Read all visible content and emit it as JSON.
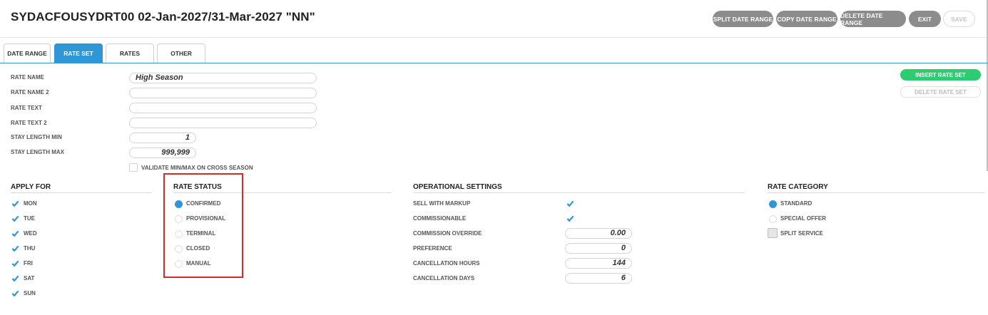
{
  "header": {
    "title": "SYDACFOUSYDRT00 02-Jan-2027/31-Mar-2027 \"NN\"",
    "buttons": {
      "split_date_range": "SPLIT DATE RANGE",
      "copy_date_range": "COPY DATE RANGE",
      "delete_date_range": "DELETE DATE RANGE",
      "exit": "EXIT",
      "save": "SAVE"
    }
  },
  "tabs": [
    {
      "label": "DATE RANGE",
      "active": false
    },
    {
      "label": "RATE SET",
      "active": true
    },
    {
      "label": "RATES",
      "active": false
    },
    {
      "label": "OTHER",
      "active": false
    }
  ],
  "form": {
    "rate_name": {
      "label": "RATE NAME",
      "value": "High Season"
    },
    "rate_name_2": {
      "label": "RATE NAME 2",
      "value": ""
    },
    "rate_text": {
      "label": "RATE TEXT",
      "value": ""
    },
    "rate_text_2": {
      "label": "RATE TEXT 2",
      "value": ""
    },
    "stay_length_min": {
      "label": "STAY LENGTH MIN",
      "value": "1"
    },
    "stay_length_max": {
      "label": "STAY LENGTH MAX",
      "value": "999,999"
    },
    "validate_cross_season": {
      "label": "VALIDATE MIN/MAX ON CROSS SEASON",
      "checked": false
    }
  },
  "actions": {
    "insert_rate_set": "INSERT RATE SET",
    "delete_rate_set": "DELETE RATE SET"
  },
  "apply_for": {
    "heading": "APPLY FOR",
    "days": [
      {
        "label": "MON",
        "checked": true
      },
      {
        "label": "TUE",
        "checked": true
      },
      {
        "label": "WED",
        "checked": true
      },
      {
        "label": "THU",
        "checked": true
      },
      {
        "label": "FRI",
        "checked": true
      },
      {
        "label": "SAT",
        "checked": true
      },
      {
        "label": "SUN",
        "checked": true
      }
    ]
  },
  "rate_status": {
    "heading": "RATE STATUS",
    "options": [
      {
        "label": "CONFIRMED",
        "selected": true
      },
      {
        "label": "PROVISIONAL",
        "selected": false
      },
      {
        "label": "TERMINAL",
        "selected": false
      },
      {
        "label": "CLOSED",
        "selected": false
      },
      {
        "label": "MANUAL",
        "selected": false
      }
    ]
  },
  "operational_settings": {
    "heading": "OPERATIONAL SETTINGS",
    "sell_with_markup": {
      "label": "SELL WITH MARKUP",
      "checked": true
    },
    "commissionable": {
      "label": "COMMISSIONABLE",
      "checked": true
    },
    "commission_override": {
      "label": "COMMISSION OVERRIDE",
      "value": "0.00"
    },
    "preference": {
      "label": "PREFERENCE",
      "value": "0"
    },
    "cancellation_hours": {
      "label": "CANCELLATION HOURS",
      "value": "144"
    },
    "cancellation_days": {
      "label": "CANCELLATION DAYS",
      "value": "6"
    }
  },
  "rate_category": {
    "heading": "RATE CATEGORY",
    "options": [
      {
        "label": "STANDARD",
        "selected": true
      },
      {
        "label": "SPECIAL OFFER",
        "selected": false
      }
    ],
    "split_service": {
      "label": "SPLIT SERVICE",
      "checked": false
    }
  },
  "colors": {
    "accent": "#2e97d8",
    "green": "#2ecc71",
    "button_gray": "#8c8c8c",
    "highlight_red": "#d62b2b"
  }
}
